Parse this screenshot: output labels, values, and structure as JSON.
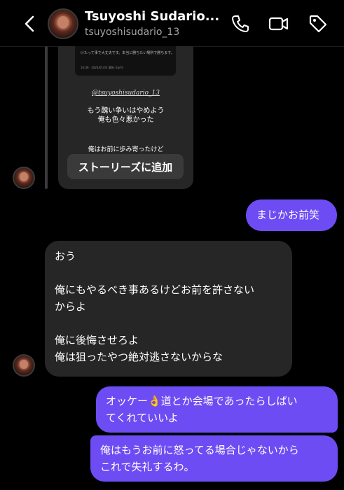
{
  "header": {
    "title": "Tsuyoshi Sudario...",
    "username": "tsuyoshisudario_13"
  },
  "icons": {
    "back": "chevron-left-icon",
    "call": "phone-icon",
    "video": "video-camera-icon",
    "tag": "tag-icon"
  },
  "story": {
    "inner_line1": "けたって事で大丈夫です。本当に勝ちたい場所で勝ちます。",
    "inner_line2": "16:36 · 2024/01/03 場所: Earth",
    "handle": "@tsuyoshisudario_13",
    "line1": "もう醜い争いはやめよう",
    "line2": "俺も色々悪かった",
    "line3": "俺はお前に歩み寄ったけど",
    "add_button": "ストーリーズに追加"
  },
  "messages": {
    "m1": "まじかお前笑",
    "m2": [
      "おう",
      "",
      "俺にもやるべき事あるけどお前を許さない",
      "からよ",
      "",
      "俺に後悔させろよ",
      "俺は狙ったやつ絶対逃さないからな"
    ],
    "m3": [
      "オッケー👌道とか会場であったらしばい",
      "てくれていいよ"
    ],
    "m4": [
      "俺はもうお前に怒ってる場合じゃないから",
      "これで失礼するわ。"
    ]
  },
  "colors": {
    "outgoing_bubble": "#6e4cf3",
    "incoming_bubble": "#262626",
    "background": "#000000"
  }
}
